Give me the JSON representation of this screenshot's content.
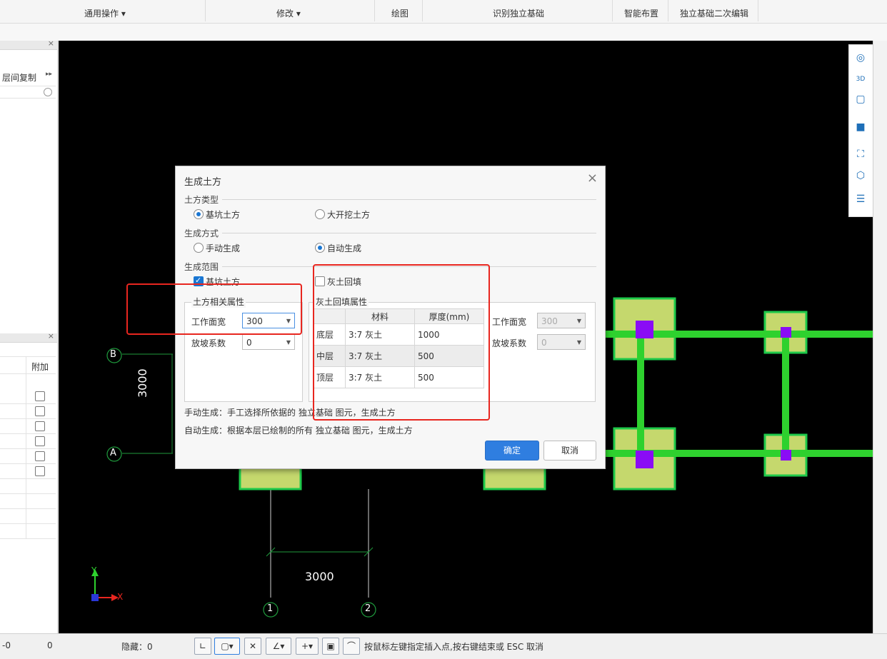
{
  "ribbon": {
    "items": [
      "通用操作",
      "修改",
      "绘图",
      "识别独立基础",
      "智能布置",
      "独立基础二次编辑"
    ]
  },
  "left_panel": {
    "layer_copy": "层间复制",
    "attach_header": "附加"
  },
  "canvas": {
    "axis_b": "B",
    "axis_a": "A",
    "axis_1": "1",
    "axis_2": "2",
    "dim_vertical": "3000",
    "dim_horizontal": "3000",
    "ucs_y": "Y",
    "ucs_x": "X",
    "colors": {
      "background": "#000000",
      "beam": "#2ed12e",
      "footing_fill": "#c5d86d",
      "footing_border": "#1ec94a",
      "column": "#8a0cf5",
      "axis_line": "#1f9a3d"
    }
  },
  "dialog": {
    "title": "生成土方",
    "earth_type_label": "土方类型",
    "earth_type_options": [
      "基坑土方",
      "大开挖土方"
    ],
    "earth_type_selected": "基坑土方",
    "gen_mode_label": "生成方式",
    "gen_mode_options": [
      "手动生成",
      "自动生成"
    ],
    "gen_mode_selected": "自动生成",
    "range_label": "生成范围",
    "range_pit_label": "基坑土方",
    "range_pit_checked": true,
    "lime_label": "灰土回填",
    "lime_checked": false,
    "earth_props_title": "土方相关属性",
    "work_width_label": "工作面宽",
    "work_width_value": "300",
    "slope_label": "放坡系数",
    "slope_value": "0",
    "lime_props_title": "灰土回填属性",
    "lime_table": {
      "headers": [
        "",
        "材料",
        "厚度(mm)"
      ],
      "rows": [
        [
          "底层",
          "3:7 灰土",
          "1000"
        ],
        [
          "中层",
          "3:7 灰土",
          "500"
        ],
        [
          "顶层",
          "3:7 灰土",
          "500"
        ]
      ]
    },
    "lime_work_width_label": "工作面宽",
    "lime_work_width_value": "300",
    "lime_slope_label": "放坡系数",
    "lime_slope_value": "0",
    "note_manual": "手动生成：手工选择所依据的 独立基础 图元，生成土方",
    "note_auto": "自动生成：根据本层已绘制的所有 独立基础 图元，生成土方",
    "ok_label": "确定",
    "cancel_label": "取消"
  },
  "status_bar": {
    "val1": "-0",
    "val2": "0",
    "hidden_label": "隐藏：0",
    "hint": "按鼠标左键指定插入点,按右键结束或 ESC 取消"
  }
}
